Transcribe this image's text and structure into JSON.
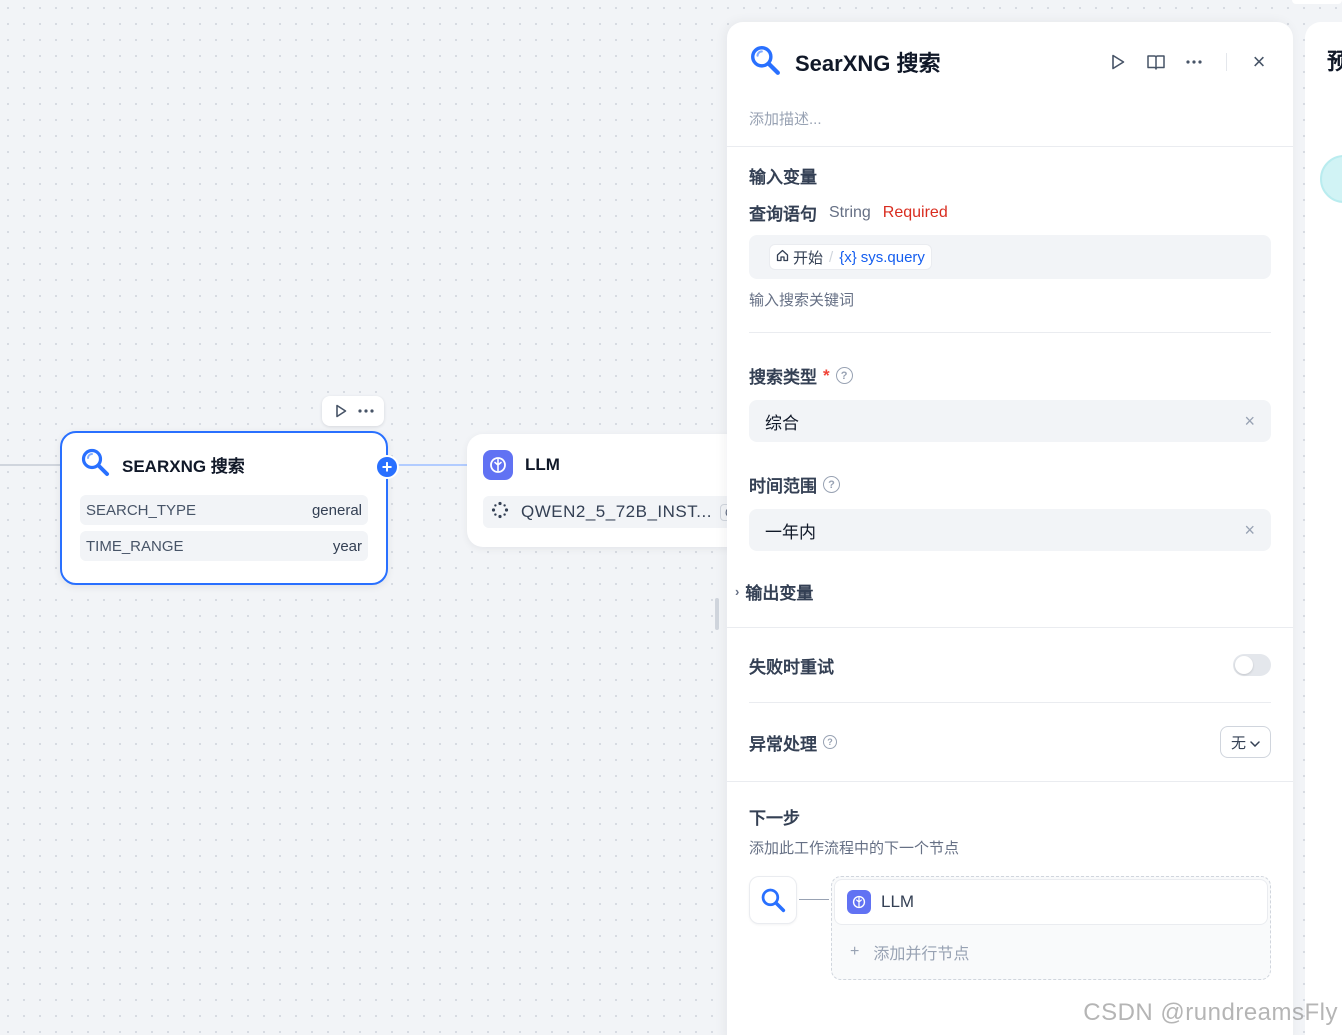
{
  "canvas": {
    "search_node": {
      "title": "SEARXNG 搜索",
      "rows": [
        {
          "key": "SEARCH_TYPE",
          "value": "general"
        },
        {
          "key": "TIME_RANGE",
          "value": "year"
        }
      ],
      "add_symbol": "+"
    },
    "llm_node": {
      "title": "LLM",
      "model": "QWEN2_5_72B_INST...",
      "model_tag_partial": "C"
    }
  },
  "panel": {
    "title": "SearXNG 搜索",
    "description_placeholder": "添加描述...",
    "input_section": {
      "title": "输入变量",
      "var_name": "查询语句",
      "var_type": "String",
      "var_required": "Required",
      "chip_source": "开始",
      "chip_separator": "/",
      "chip_var_prefix": "{x}",
      "chip_var": "sys.query",
      "hint": "输入搜索关键词"
    },
    "search_type": {
      "label": "搜索类型",
      "required_mark": "*",
      "help": "?",
      "value": "综合"
    },
    "time_range": {
      "label": "时间范围",
      "help": "?",
      "value": "一年内"
    },
    "output_section": {
      "title": "输出变量"
    },
    "retry": {
      "label": "失败时重试",
      "enabled": false
    },
    "error_handling": {
      "label": "异常处理",
      "help": "?",
      "value": "无"
    },
    "next_step": {
      "title": "下一步",
      "description": "添加此工作流程中的下一个节点",
      "next_node_label": "LLM",
      "add_parallel": "添加并行节点",
      "add_symbol": "+"
    },
    "clear_symbol": "×",
    "close_symbol": "×"
  },
  "side_panel": {
    "title_partial": "预"
  },
  "watermark": "CSDN @rundreamsFly",
  "colors": {
    "accent": "#2970ff",
    "required": "#d92d20",
    "llm_icon": "#6172f3"
  }
}
